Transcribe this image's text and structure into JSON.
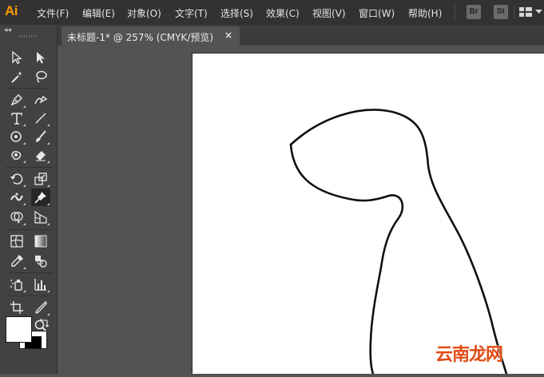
{
  "app": {
    "logo": "Ai"
  },
  "menu": {
    "items": [
      "文件(F)",
      "编辑(E)",
      "对象(O)",
      "文字(T)",
      "选择(S)",
      "效果(C)",
      "视图(V)",
      "窗口(W)",
      "帮助(H)"
    ],
    "bridge_buttons": [
      "Br",
      "St"
    ]
  },
  "toolbar": {
    "collapse_label": "◂◂",
    "tools": [
      "selection-tool",
      "direct-selection-tool",
      "magic-wand-tool",
      "lasso-tool",
      "pen-tool",
      "curvature-tool",
      "type-tool",
      "line-segment-tool",
      "ellipse-tool",
      "paintbrush-tool",
      "shaper-tool",
      "eraser-tool",
      "rotate-tool",
      "scale-tool",
      "width-tool",
      "puppet-warp-tool",
      "shape-builder-tool",
      "perspective-grid-tool",
      "mesh-tool",
      "gradient-tool",
      "eyedropper-tool",
      "blend-tool",
      "symbol-sprayer-tool",
      "column-graph-tool",
      "artboard-tool",
      "slice-tool",
      "hand-tool",
      "zoom-tool"
    ],
    "selected_tool": "puppet-warp-tool",
    "fill_color": "#ffffff",
    "stroke_color": "#000000"
  },
  "document": {
    "tab_label": "未标题-1* @ 257% (CMYK/预览)",
    "close_glyph": "×"
  },
  "watermark": "云南龙网"
}
